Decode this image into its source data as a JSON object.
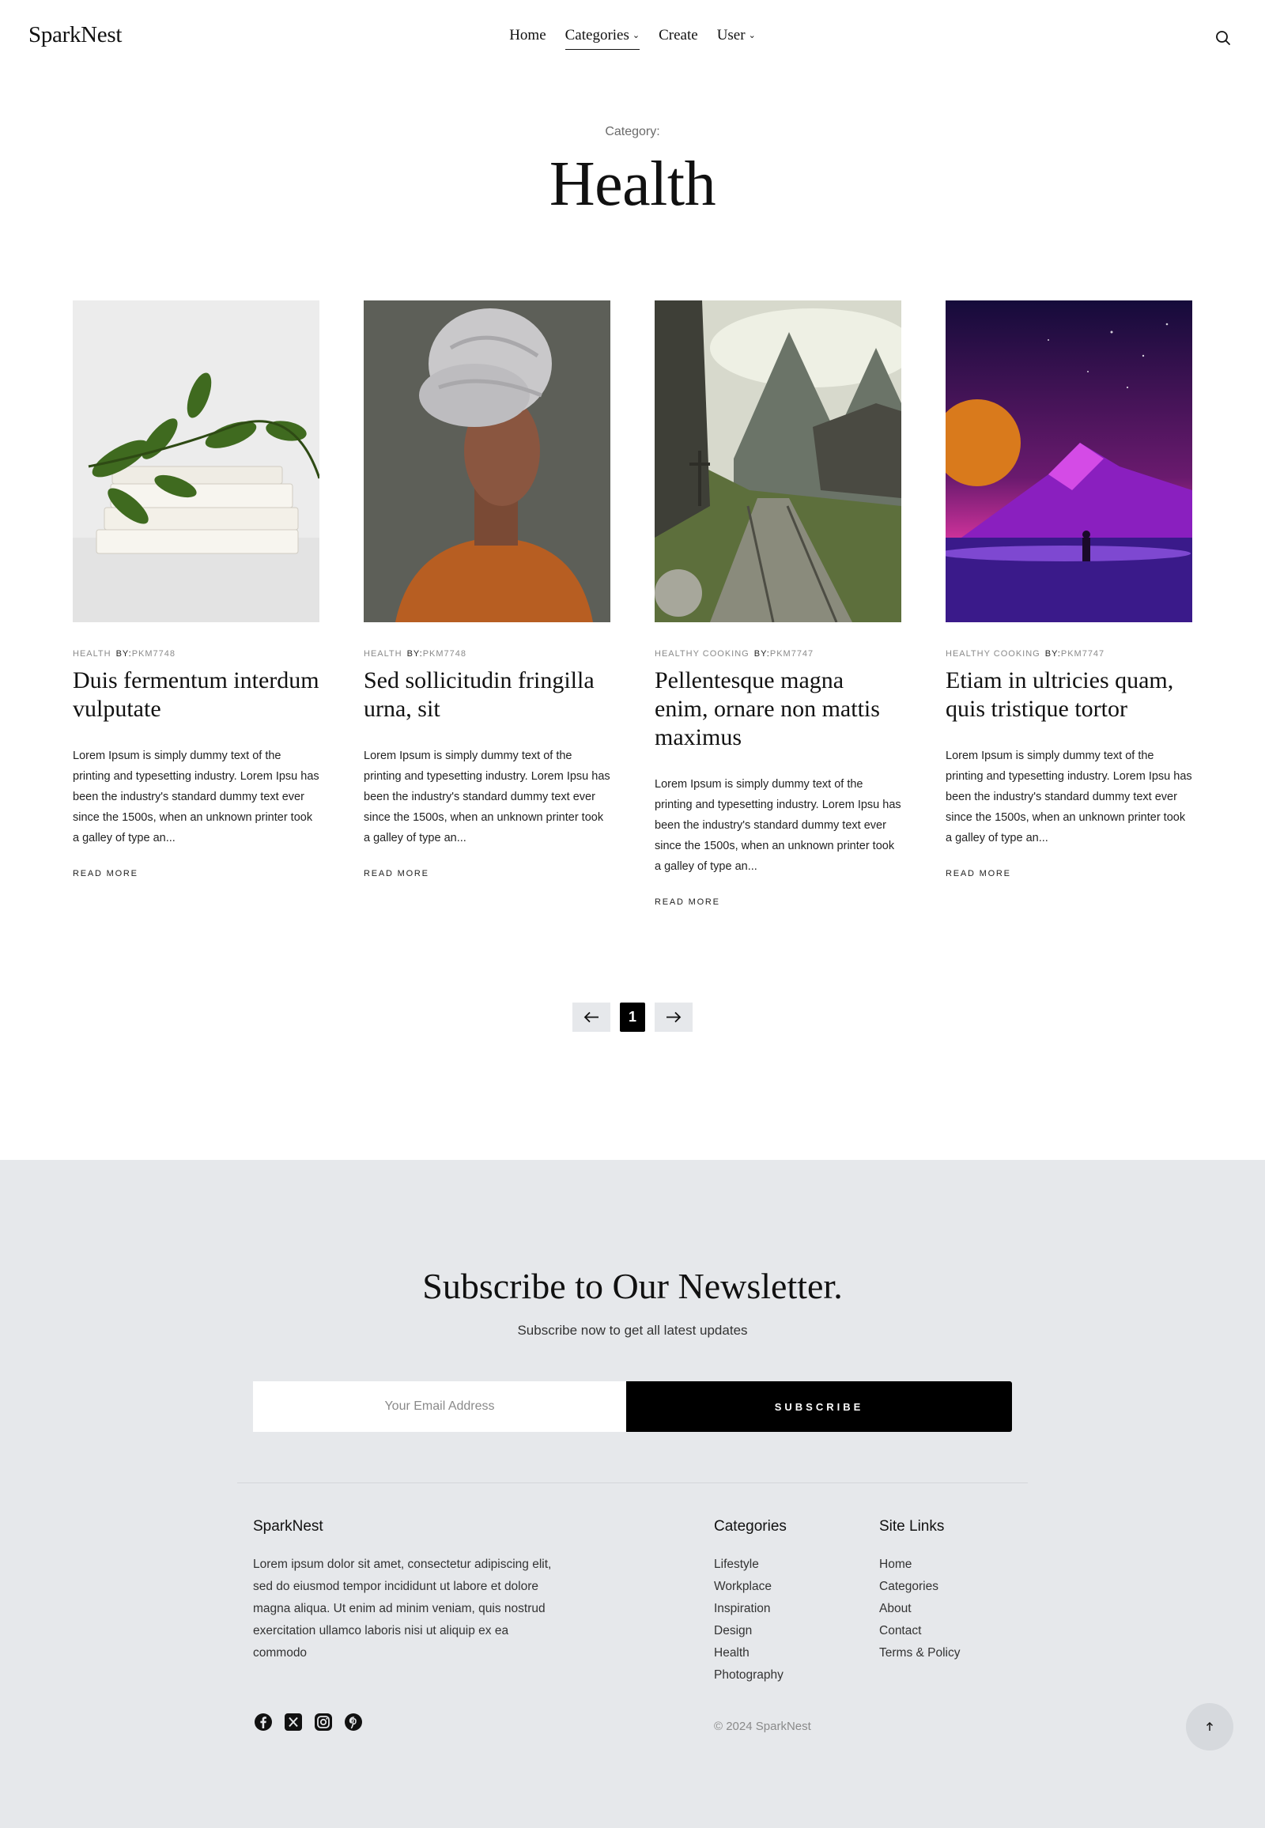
{
  "header": {
    "logo": "SparkNest",
    "nav": [
      {
        "label": "Home"
      },
      {
        "label": "Categories"
      },
      {
        "label": "Create"
      },
      {
        "label": "User"
      }
    ]
  },
  "page": {
    "category_label": "Category:",
    "category_title": "Health"
  },
  "posts": [
    {
      "category": "HEALTH",
      "by": "BY:",
      "author": "PKM7748",
      "title": "Duis fermentum interdum vulputate",
      "excerpt": "Lorem Ipsum is simply dummy text of the printing and typesetting industry. Lorem Ipsu has been the industry's standard dummy text ever since the 1500s, when an unknown printer took a galley of type an...",
      "read_more": "READ MORE"
    },
    {
      "category": "HEALTH",
      "by": "BY:",
      "author": "PKM7748",
      "title": "Sed sollicitudin fringilla urna, sit",
      "excerpt": "Lorem Ipsum is simply dummy text of the printing and typesetting industry. Lorem Ipsu has been the industry's standard dummy text ever since the 1500s, when an unknown printer took a galley of type an...",
      "read_more": "READ MORE"
    },
    {
      "category": "HEALTHY COOKING",
      "by": "BY:",
      "author": "PKM7747",
      "title": "Pellentesque magna enim, ornare non mattis maximus",
      "excerpt": "Lorem Ipsum is simply dummy text of the printing and typesetting industry. Lorem Ipsu has been the industry's standard dummy text ever since the 1500s, when an unknown printer took a galley of type an...",
      "read_more": "READ MORE"
    },
    {
      "category": "HEALTHY COOKING",
      "by": "BY:",
      "author": "PKM7747",
      "title": "Etiam in ultricies quam, quis tristique tortor",
      "excerpt": "Lorem Ipsum is simply dummy text of the printing and typesetting industry. Lorem Ipsu has been the industry's standard dummy text ever since the 1500s, when an unknown printer took a galley of type an...",
      "read_more": "READ MORE"
    }
  ],
  "pagination": {
    "current": "1"
  },
  "newsletter": {
    "title": "Subscribe to Our Newsletter.",
    "subtitle": "Subscribe now to get all latest updates",
    "placeholder": "Your Email Address",
    "button": "SUBSCRIBE"
  },
  "footer": {
    "brand": "SparkNest",
    "about": "Lorem ipsum dolor sit amet, consectetur adipiscing elit, sed do eiusmod tempor incididunt ut labore et dolore magna aliqua. Ut enim ad minim veniam, quis nostrud exercitation ullamco laboris nisi ut aliquip ex ea commodo",
    "categories_title": "Categories",
    "categories": [
      "Lifestyle",
      "Workplace",
      "Inspiration",
      "Design",
      "Health",
      "Photography"
    ],
    "sitelinks_title": "Site Links",
    "sitelinks": [
      "Home",
      "Categories",
      "About",
      "Contact",
      "Terms & Policy"
    ],
    "copyright": "© 2024 SparkNest",
    "social": [
      "facebook-icon",
      "x-icon",
      "instagram-icon",
      "pinterest-icon"
    ]
  }
}
